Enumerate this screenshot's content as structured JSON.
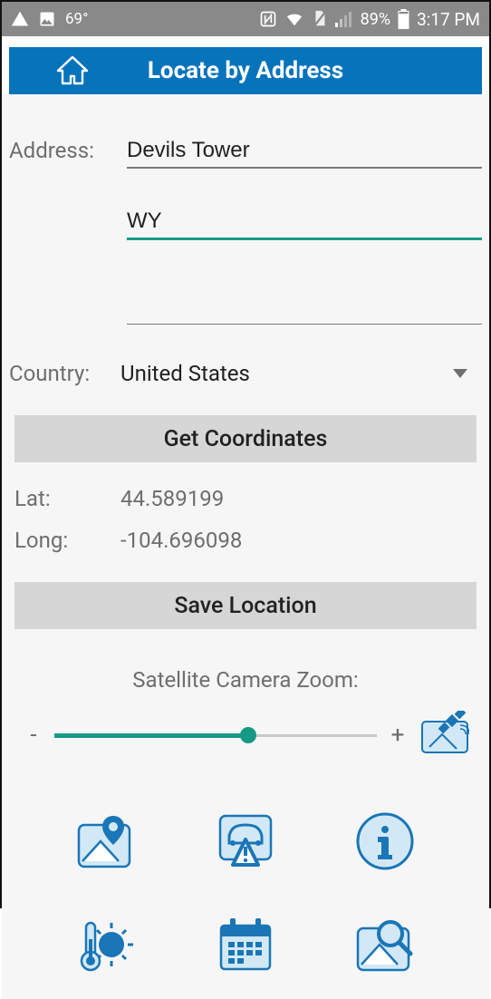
{
  "status_bar": {
    "temperature": "69°",
    "battery_percent": "89%",
    "time": "3:17 PM",
    "icons": {
      "warning": "warning-triangle-icon",
      "image": "image-icon",
      "nfc": "nfc-icon",
      "wifi": "wifi-icon",
      "nosim": "no-sim-icon",
      "signal": "cell-signal-icon",
      "battery": "battery-icon"
    }
  },
  "header": {
    "title": "Locate by Address",
    "home_icon": "home-icon"
  },
  "form": {
    "address_label": "Address:",
    "address_line1": "Devils Tower",
    "address_line2": "WY",
    "address_line3": "",
    "country_label": "Country:",
    "country_value": "United States"
  },
  "buttons": {
    "get_coords": "Get Coordinates",
    "save_location": "Save Location"
  },
  "coords": {
    "lat_label": "Lat:",
    "lat_value": "44.589199",
    "long_label": "Long:",
    "long_value": "-104.696098"
  },
  "zoom": {
    "label": "Satellite Camera Zoom:",
    "minus": "-",
    "plus": "+",
    "value_fraction": 0.6,
    "satellite_icon": "satellite-icon"
  },
  "bottom_icons": {
    "map_pin": "map-pin-icon",
    "traffic": "traffic-alert-icon",
    "info": "info-icon",
    "weather": "weather-thermometer-icon",
    "calendar": "calendar-icon",
    "search_map": "search-map-icon"
  }
}
